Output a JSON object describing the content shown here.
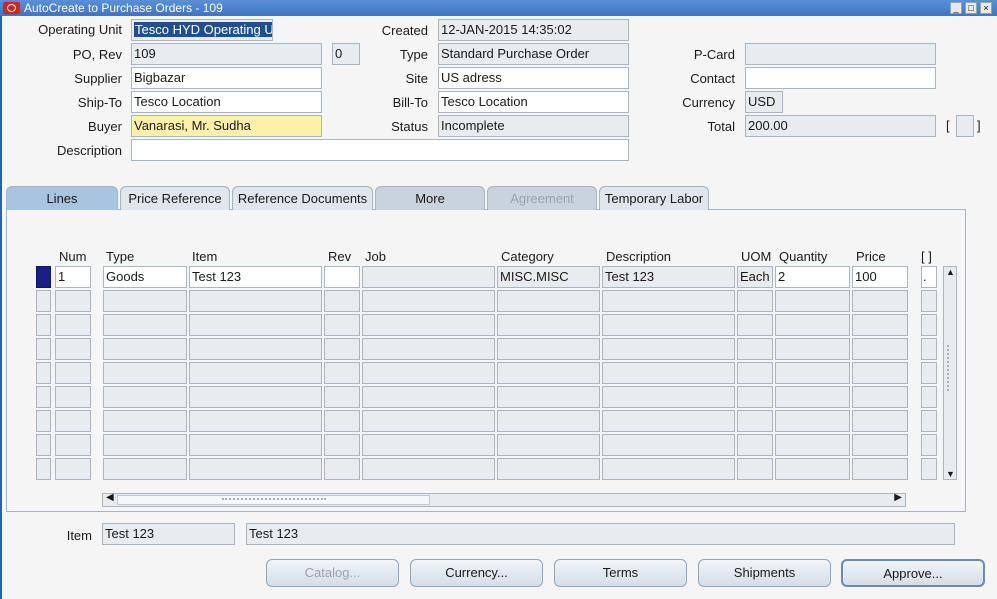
{
  "window": {
    "title": "AutoCreate to Purchase Orders - 109"
  },
  "header": {
    "operating_unit_label": "Operating Unit",
    "operating_unit": "Tesco HYD Operating U",
    "po_rev_label": "PO, Rev",
    "po": "109",
    "rev": "0",
    "supplier_label": "Supplier",
    "supplier": "Bigbazar",
    "ship_to_label": "Ship-To",
    "ship_to": "Tesco Location",
    "buyer_label": "Buyer",
    "buyer": "Vanarasi, Mr. Sudha",
    "description_label": "Description",
    "description": "",
    "created_label": "Created",
    "created": "12-JAN-2015 14:35:02",
    "type_label": "Type",
    "type": "Standard Purchase Order",
    "site_label": "Site",
    "site": "US adress",
    "bill_to_label": "Bill-To",
    "bill_to": "Tesco Location",
    "status_label": "Status",
    "status": "Incomplete",
    "pcard_label": "P-Card",
    "pcard": "",
    "contact_label": "Contact",
    "contact": "",
    "currency_label": "Currency",
    "currency": "USD",
    "total_label": "Total",
    "total": "200.00",
    "bracket_open": "[",
    "bracket_close": "]"
  },
  "tabs": [
    {
      "label": "Lines"
    },
    {
      "label": "Price Reference"
    },
    {
      "label": "Reference Documents"
    },
    {
      "label": "More"
    },
    {
      "label": "Agreement"
    },
    {
      "label": "Temporary Labor"
    }
  ],
  "lines": {
    "columns": {
      "num": "Num",
      "type": "Type",
      "item": "Item",
      "rev": "Rev",
      "job": "Job",
      "category": "Category",
      "description": "Description",
      "uom": "UOM",
      "quantity": "Quantity",
      "price": "Price",
      "flex": "[ ]"
    },
    "row1": {
      "num": "1",
      "type": "Goods",
      "item": "Test 123",
      "rev": "",
      "job": "",
      "category": "MISC.MISC",
      "description": "Test 123",
      "uom": "Each",
      "quantity": "2",
      "price": "100",
      "flex": "."
    }
  },
  "footer": {
    "item_label": "Item",
    "item": "Test 123",
    "item_description": "Test 123"
  },
  "buttons": {
    "catalog": "Catalog...",
    "currency": "Currency...",
    "terms": "Terms",
    "shipments": "Shipments",
    "approve": "Approve..."
  }
}
